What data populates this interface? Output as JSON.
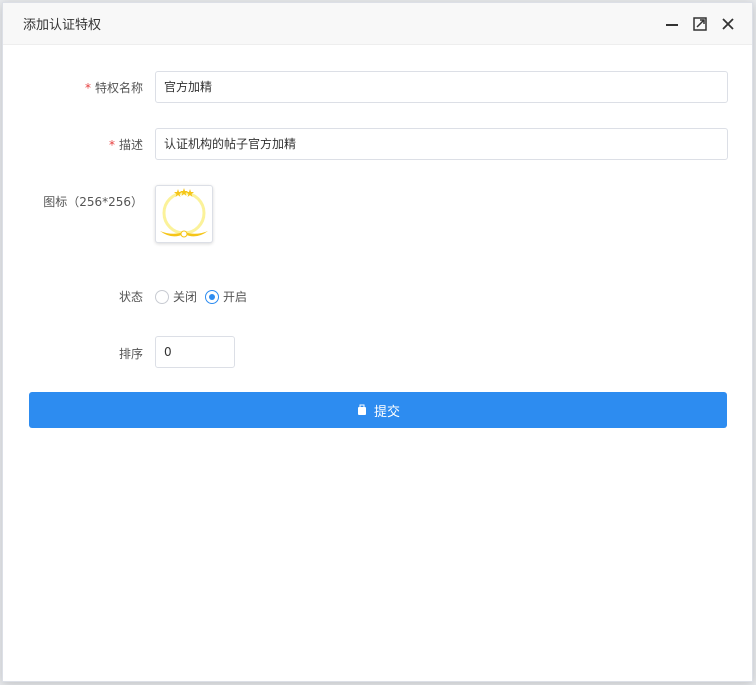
{
  "dialog": {
    "title": "添加认证特权",
    "controls": {
      "minimize_icon": "minimize-icon",
      "maximize_icon": "maximize-icon",
      "close_icon": "close-icon"
    }
  },
  "form": {
    "name": {
      "label": "特权名称",
      "required": true,
      "value": "官方加精"
    },
    "description": {
      "label": "描述",
      "required": true,
      "value": "认证机构的帖子官方加精"
    },
    "icon": {
      "label": "图标（256*256）",
      "icon_name": "gold-wreath-badge-icon",
      "colors": {
        "gold": "#f5c518",
        "ring": "#fbf29a"
      }
    },
    "status": {
      "label": "状态",
      "options": [
        {
          "label": "关闭",
          "checked": false
        },
        {
          "label": "开启",
          "checked": true
        }
      ]
    },
    "order": {
      "label": "排序",
      "value": "0"
    },
    "submit": {
      "label": "提交",
      "icon": "bag-icon"
    }
  },
  "colors": {
    "accent": "#2d8cf0",
    "required": "#e63e3e"
  }
}
